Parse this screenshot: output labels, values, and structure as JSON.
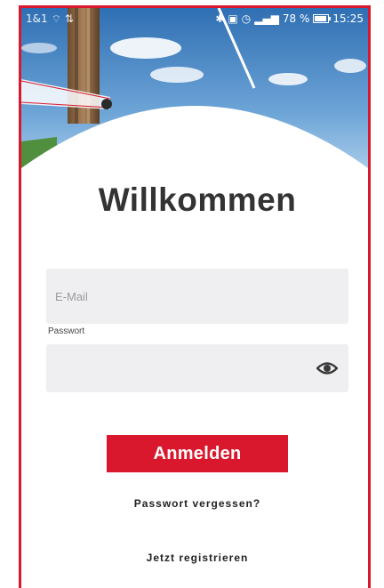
{
  "status_bar": {
    "carrier": "1&1",
    "battery_percent": "78 %",
    "time": "15:25"
  },
  "login": {
    "title": "Willkommen",
    "email_placeholder": "E-Mail",
    "email_value": "",
    "password_label": "Passwort",
    "password_value": "",
    "submit_label": "Anmelden",
    "forgot_password_label": "Passwort vergessen?",
    "register_label": "Jetzt registrieren"
  },
  "colors": {
    "brand_red": "#d9182d",
    "field_bg": "#efeff1",
    "title_text": "#333333"
  },
  "icons": {
    "password_toggle": "eye-icon"
  }
}
